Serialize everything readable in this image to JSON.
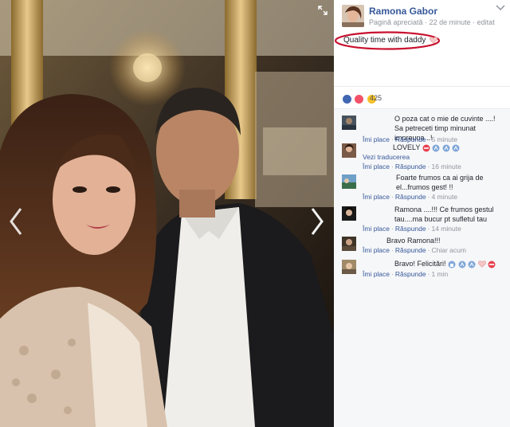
{
  "post": {
    "page_name": "Ramona Gabor",
    "meta": {
      "page_status": "Pagină apreciată",
      "time": "22 de minute",
      "edited": "editat"
    },
    "caption": "Quality time with daddy"
  },
  "reactions": {
    "count": "425",
    "icons": [
      "like-icon",
      "love-icon",
      "wow-icon"
    ]
  },
  "actions": {
    "like": "Îmi place",
    "reply": "Răspunde",
    "separator": "·"
  },
  "comments": [
    {
      "text": "O poza cat o mie de cuvinte ....! Sa petreceti timp minunat impreuna ..!",
      "time": "5 minute",
      "translate": ""
    },
    {
      "text": "LOVELY",
      "time": "16 minute",
      "translate": "Vezi traducerea"
    },
    {
      "text": "Foarte frumos ca ai grija de el...frumos gest! !!",
      "time": "4 minute",
      "translate": ""
    },
    {
      "text": "Ramona ....!!! Ce frumos gestul tau....ma bucur pt sufletul tau",
      "time": "14 minute",
      "translate": ""
    },
    {
      "text": "Bravo Ramona!!!",
      "time": "Chiar acum",
      "translate": ""
    },
    {
      "text": "Bravo! Felicitări!",
      "time": "1 min",
      "translate": ""
    }
  ],
  "colors": {
    "link": "#365899",
    "meta": "#90949c",
    "annotation_red": "#c8102e"
  }
}
